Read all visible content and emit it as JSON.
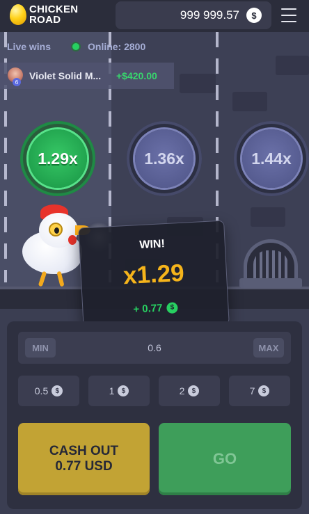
{
  "header": {
    "logo_line1": "CHICKEN",
    "logo_line2": "ROAD",
    "balance": "999 999.57",
    "currency_icon": "dollar-coin-icon",
    "menu_icon": "hamburger-menu-icon"
  },
  "feed": {
    "live_wins_label": "Live wins",
    "online_label": "Online: 2800",
    "latest_win": {
      "player": "Violet Solid M...",
      "badge": "6",
      "amount": "+$420.00"
    }
  },
  "lanes": {
    "multipliers": [
      {
        "label": "1.29x",
        "state": "active"
      },
      {
        "label": "1.36x",
        "state": "locked"
      },
      {
        "label": "1.44x",
        "state": "locked"
      }
    ]
  },
  "win_popup": {
    "title": "WIN!",
    "multiplier": "x1.29",
    "amount": "+ 0.77",
    "currency_symbol": "$"
  },
  "bet": {
    "min_label": "MIN",
    "max_label": "MAX",
    "value": "0.6",
    "currency_symbol": "$",
    "quick_amounts": [
      "0.5",
      "1",
      "2",
      "7"
    ]
  },
  "actions": {
    "cashout_line1": "CASH OUT",
    "cashout_line2": "0.77 USD",
    "go_label": "GO"
  },
  "colors": {
    "accent_green": "#27d061",
    "accent_gold": "#f5b41b",
    "cashout_bg": "#c2a334",
    "go_bg": "#3e9e5a",
    "bg_dark": "#2e3040"
  }
}
